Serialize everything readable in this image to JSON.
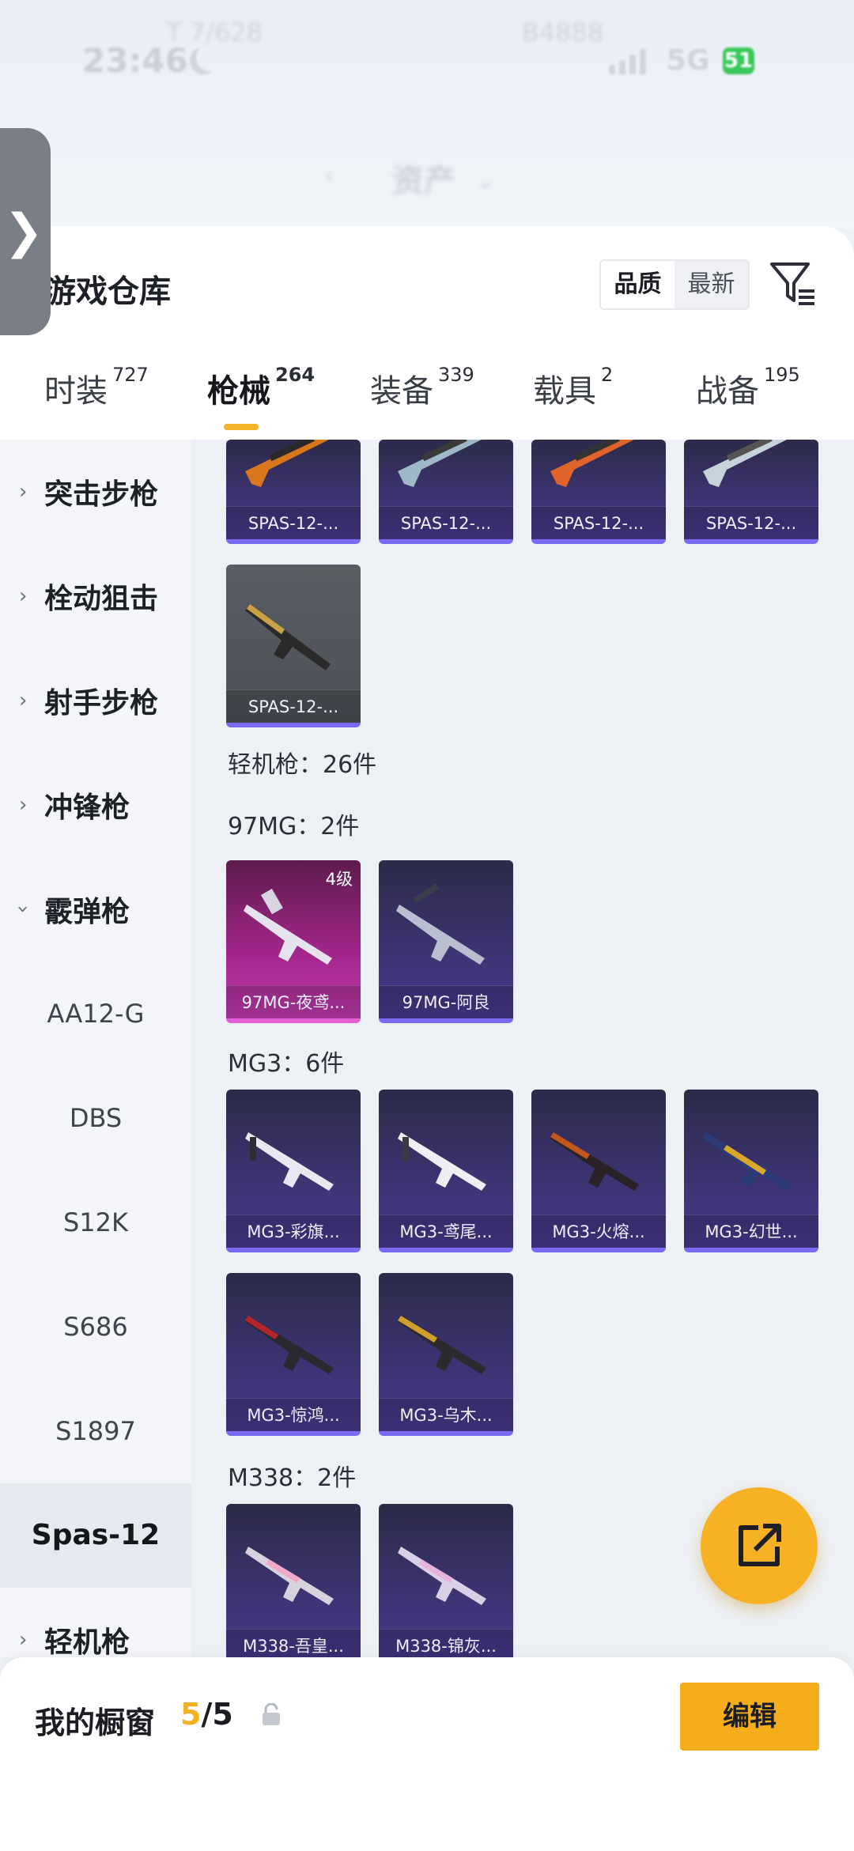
{
  "status": {
    "time": "23:46",
    "notif_1": "T 7/628",
    "notif_2": "B4888",
    "network": "5G",
    "battery": "51"
  },
  "top_nav": {
    "back": "‹",
    "title": "资产",
    "chevron": "⌄"
  },
  "drawer": {
    "handle": "❯"
  },
  "panel": {
    "title": "游戏仓库",
    "sort_options": [
      "品质",
      "最新"
    ],
    "active_sort": "品质"
  },
  "tabs": [
    {
      "label": "时装",
      "count": "727"
    },
    {
      "label": "枪械",
      "count": "264"
    },
    {
      "label": "装备",
      "count": "339"
    },
    {
      "label": "载具",
      "count": "2"
    },
    {
      "label": "战备",
      "count": "195"
    }
  ],
  "active_tab": "枪械",
  "sidebar": {
    "categories": [
      "突击步枪",
      "栓动狙击",
      "射手步枪",
      "冲锋枪",
      "霰弹枪"
    ],
    "shotgun_subitems": [
      "AA12-G",
      "DBS",
      "S12K",
      "S686",
      "S1897",
      "Spas-12"
    ],
    "selected_subitem": "Spas-12",
    "last_category": "轻机枪"
  },
  "content": {
    "spas_row_cut": [
      "SPAS-12-...",
      "SPAS-12-...",
      "SPAS-12-...",
      "SPAS-12-..."
    ],
    "spas_extra": "SPAS-12-...",
    "lmg_total": "轻机枪：26件",
    "group_97mg": "97MG：2件",
    "cards_97mg": [
      {
        "name": "97MG-夜鸢...",
        "level": "4级"
      },
      {
        "name": "97MG-阿良"
      }
    ],
    "group_mg3": "MG3：6件",
    "cards_mg3": [
      "MG3-彩旗...",
      "MG3-鸢尾...",
      "MG3-火熔...",
      "MG3-幻世...",
      "MG3-惊鸿...",
      "MG3-乌木..."
    ],
    "group_m338": "M338：2件",
    "cards_m338": [
      "M338-吾皇...",
      "M338-锦灰..."
    ]
  },
  "bottom": {
    "window_label": "我的橱窗",
    "window_current": "5",
    "window_total": "/5",
    "edit_label": "编辑"
  },
  "colors": {
    "accent": "#f6ad1c",
    "tab_underline": "#f5b52b",
    "card_purple": "#3c3370",
    "card_pink": "#a4268c"
  }
}
